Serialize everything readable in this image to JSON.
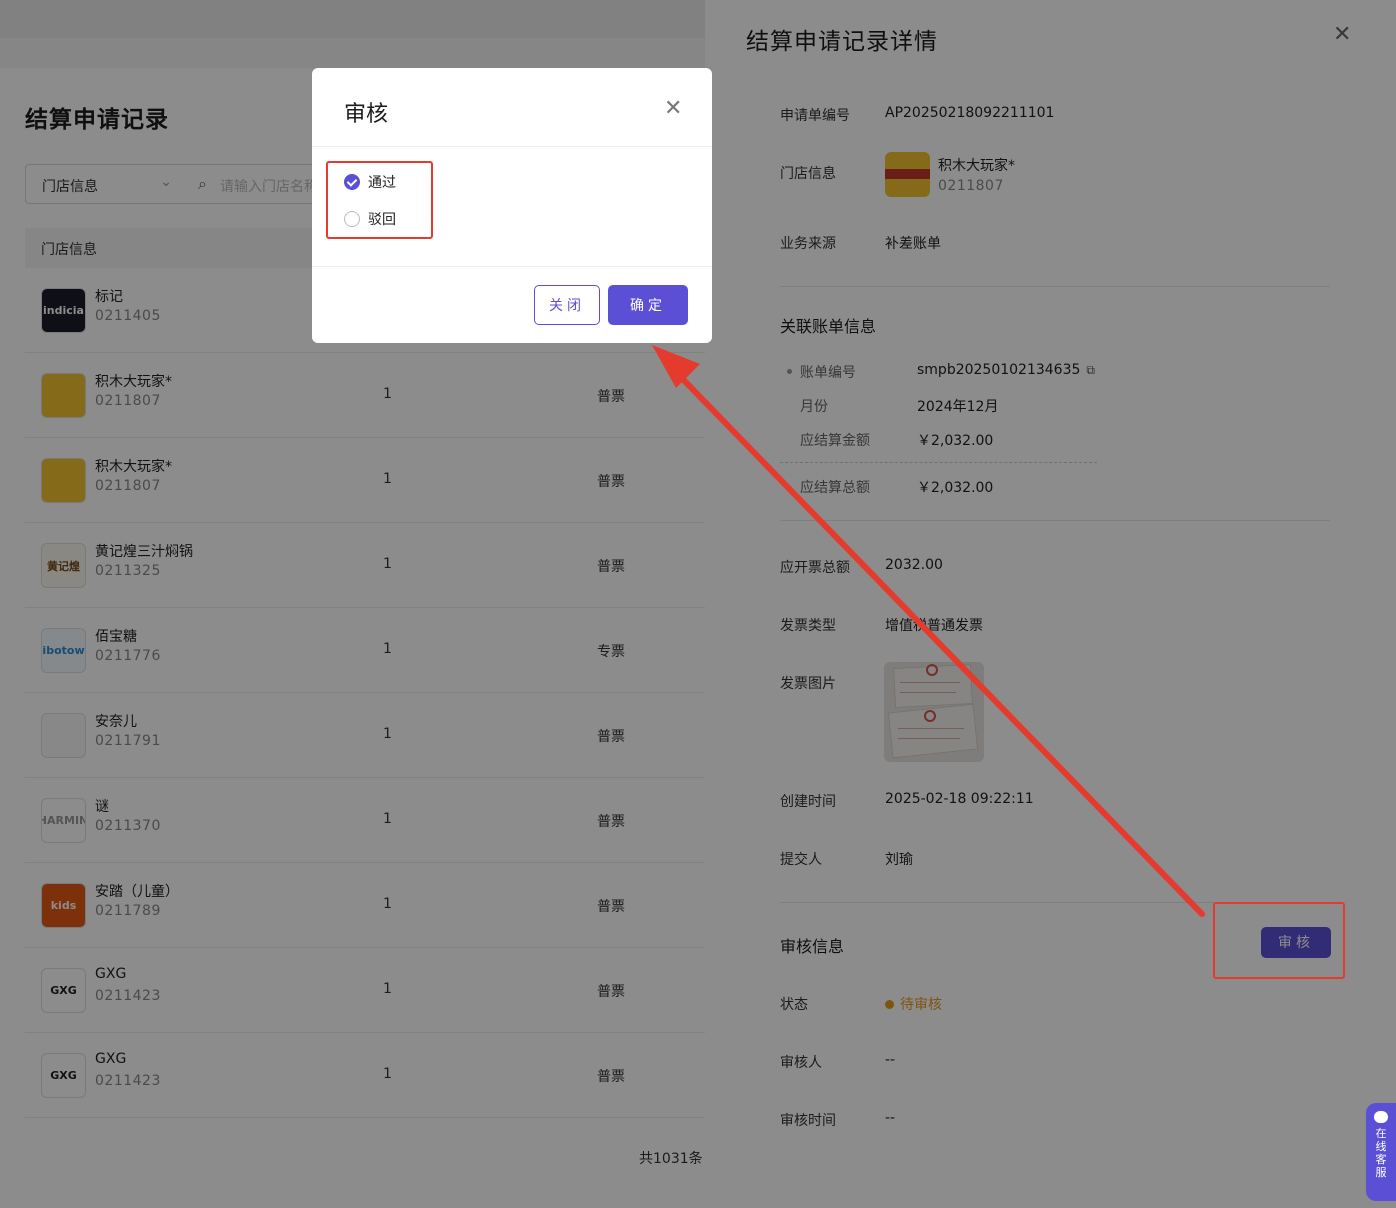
{
  "list_page": {
    "title": "结算申请记录",
    "filter_select": "门店信息",
    "search_placeholder": "请输入门店名称",
    "column_header": "门店信息",
    "rows": [
      {
        "name": "标记",
        "code": "0211405",
        "qty": "",
        "type": ""
      },
      {
        "name": "积木大玩家*",
        "code": "0211807",
        "qty": "1",
        "type": "普票"
      },
      {
        "name": "积木大玩家*",
        "code": "0211807",
        "qty": "1",
        "type": "普票"
      },
      {
        "name": "黄记煌三汁焖锅",
        "code": "0211325",
        "qty": "1",
        "type": "普票"
      },
      {
        "name": "佰宝糖",
        "code": "0211776",
        "qty": "1",
        "type": "专票"
      },
      {
        "name": "安奈儿",
        "code": "0211791",
        "qty": "1",
        "type": "普票"
      },
      {
        "name": "谜",
        "code": "0211370",
        "qty": "1",
        "type": "普票"
      },
      {
        "name": "安踏（儿童）",
        "code": "0211789",
        "qty": "1",
        "type": "普票"
      },
      {
        "name": "GXG",
        "code": "0211423",
        "qty": "1",
        "type": "普票"
      },
      {
        "name": "GXG",
        "code": "0211423",
        "qty": "1",
        "type": "普票"
      }
    ],
    "logo_texts": [
      "indicia",
      "",
      "",
      "黄记煌",
      "bibotown",
      "",
      "CHARMING",
      "kids",
      "GXG",
      "GXG"
    ],
    "total": "共1031条"
  },
  "drawer": {
    "title": "结算申请记录详情",
    "fields": {
      "app_no_label": "申请单编号",
      "app_no": "AP20250218092211101",
      "store_label": "门店信息",
      "store_name": "积木大玩家*",
      "store_code": "0211807",
      "source_label": "业务来源",
      "source": "补差账单",
      "bill_section": "关联账单信息",
      "bill_no_label": "账单编号",
      "bill_no": "smpb20250102134635",
      "month_label": "月份",
      "month": "2024年12月",
      "due_label": "应结算金额",
      "due": "￥2,032.00",
      "total_due_label": "应结算总额",
      "total_due": "￥2,032.00",
      "invoice_total_label": "应开票总额",
      "invoice_total": "2032.00",
      "invoice_type_label": "发票类型",
      "invoice_type": "增值税普通发票",
      "invoice_img_label": "发票图片",
      "created_label": "创建时间",
      "created": "2025-02-18 09:22:11",
      "submitter_label": "提交人",
      "submitter": "刘瑜",
      "audit_section": "审核信息",
      "audit_button": "审核",
      "status_label": "状态",
      "status": "待审核",
      "auditor_label": "审核人",
      "auditor": "--",
      "audit_time_label": "审核时间",
      "audit_time": "--"
    }
  },
  "modal": {
    "title": "审核",
    "options": [
      {
        "label": "通过",
        "checked": true
      },
      {
        "label": "驳回",
        "checked": false
      }
    ],
    "close_button": "关闭",
    "confirm_button": "确定"
  },
  "support_widget": "在线客服",
  "colors": {
    "accent": "#5b4fd6",
    "annotation": "#e53a2e",
    "pending": "#e89a1c"
  }
}
